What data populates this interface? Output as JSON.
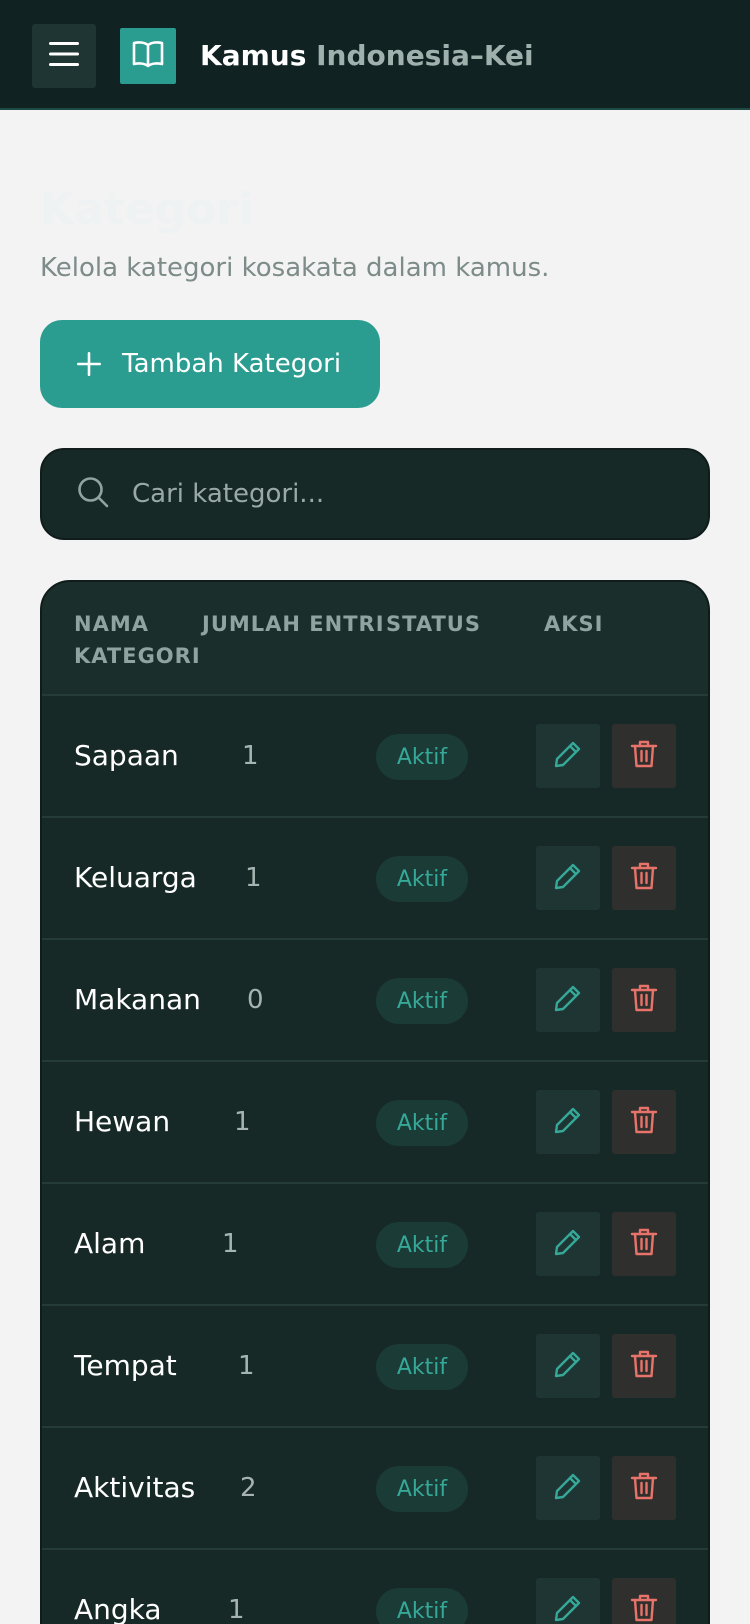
{
  "header": {
    "title_bold": "Kamus",
    "title_rest": "Indonesia–Kei",
    "menu_icon": "hamburger-icon",
    "logo_icon": "book-icon"
  },
  "page": {
    "title": "Kategori",
    "subtitle": "Kelola kategori kosakata dalam kamus."
  },
  "actions": {
    "add_label": "Tambah Kategori"
  },
  "search": {
    "placeholder": "Cari kategori..."
  },
  "table": {
    "headers": {
      "name": "NAMA KATEGORI",
      "count": "JUMLAH ENTRI",
      "status": "STATUS",
      "actions": "AKSI"
    },
    "rows": [
      {
        "name": "Sapaan",
        "count": "1",
        "status": "Aktif"
      },
      {
        "name": "Keluarga",
        "count": "1",
        "status": "Aktif"
      },
      {
        "name": "Makanan",
        "count": "0",
        "status": "Aktif"
      },
      {
        "name": "Hewan",
        "count": "1",
        "status": "Aktif"
      },
      {
        "name": "Alam",
        "count": "1",
        "status": "Aktif"
      },
      {
        "name": "Tempat",
        "count": "1",
        "status": "Aktif"
      },
      {
        "name": "Aktivitas",
        "count": "2",
        "status": "Aktif"
      },
      {
        "name": "Angka",
        "count": "1",
        "status": "Aktif"
      }
    ]
  },
  "colors": {
    "accent": "#2a9d90",
    "topbar": "#102221",
    "table_bg": "#172927",
    "delete": "#e8736a"
  }
}
